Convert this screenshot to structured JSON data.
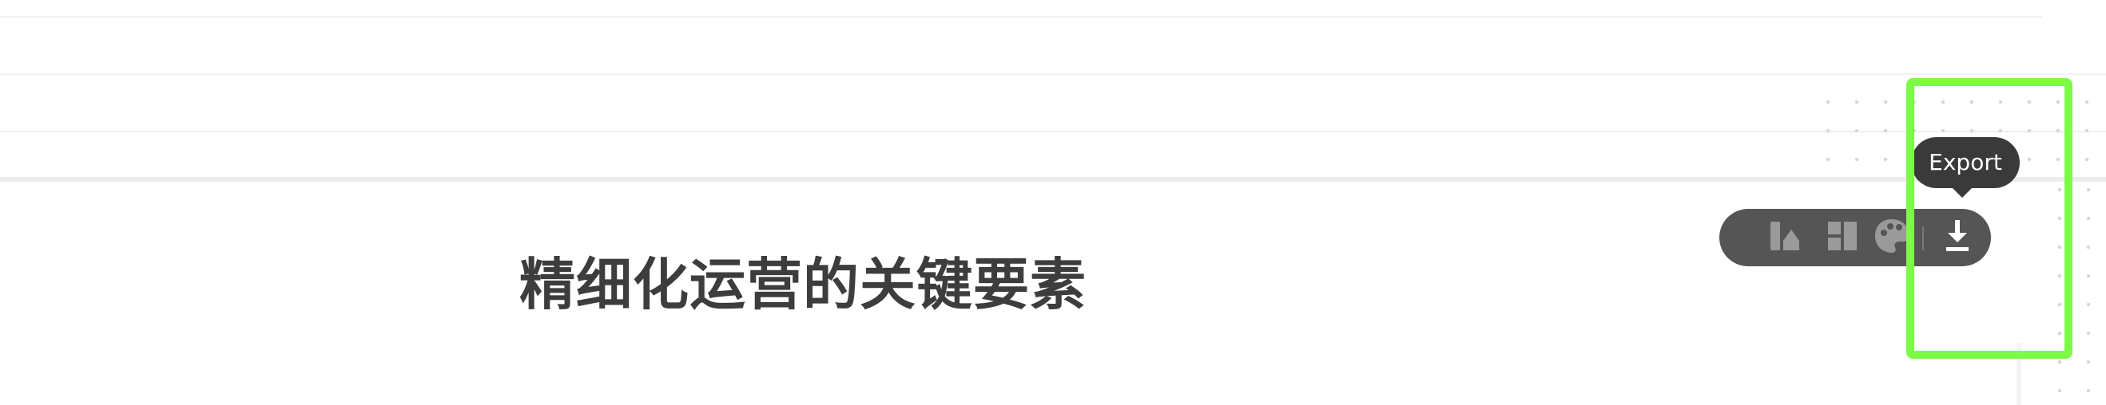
{
  "slide": {
    "title": "精细化运营的关键要素"
  },
  "toolbar": {
    "buttons": [
      {
        "name": "layout-variant-icon",
        "interactable": true
      },
      {
        "name": "grid-layout-icon",
        "interactable": true
      },
      {
        "name": "palette-icon",
        "interactable": true
      },
      {
        "name": "download-icon",
        "interactable": true
      }
    ],
    "tooltip": "Export",
    "background_color": "#555555",
    "icon_color_inactive": "#9a9a9a",
    "icon_color_active": "#ffffff"
  },
  "highlight_color": "#7dfa46"
}
